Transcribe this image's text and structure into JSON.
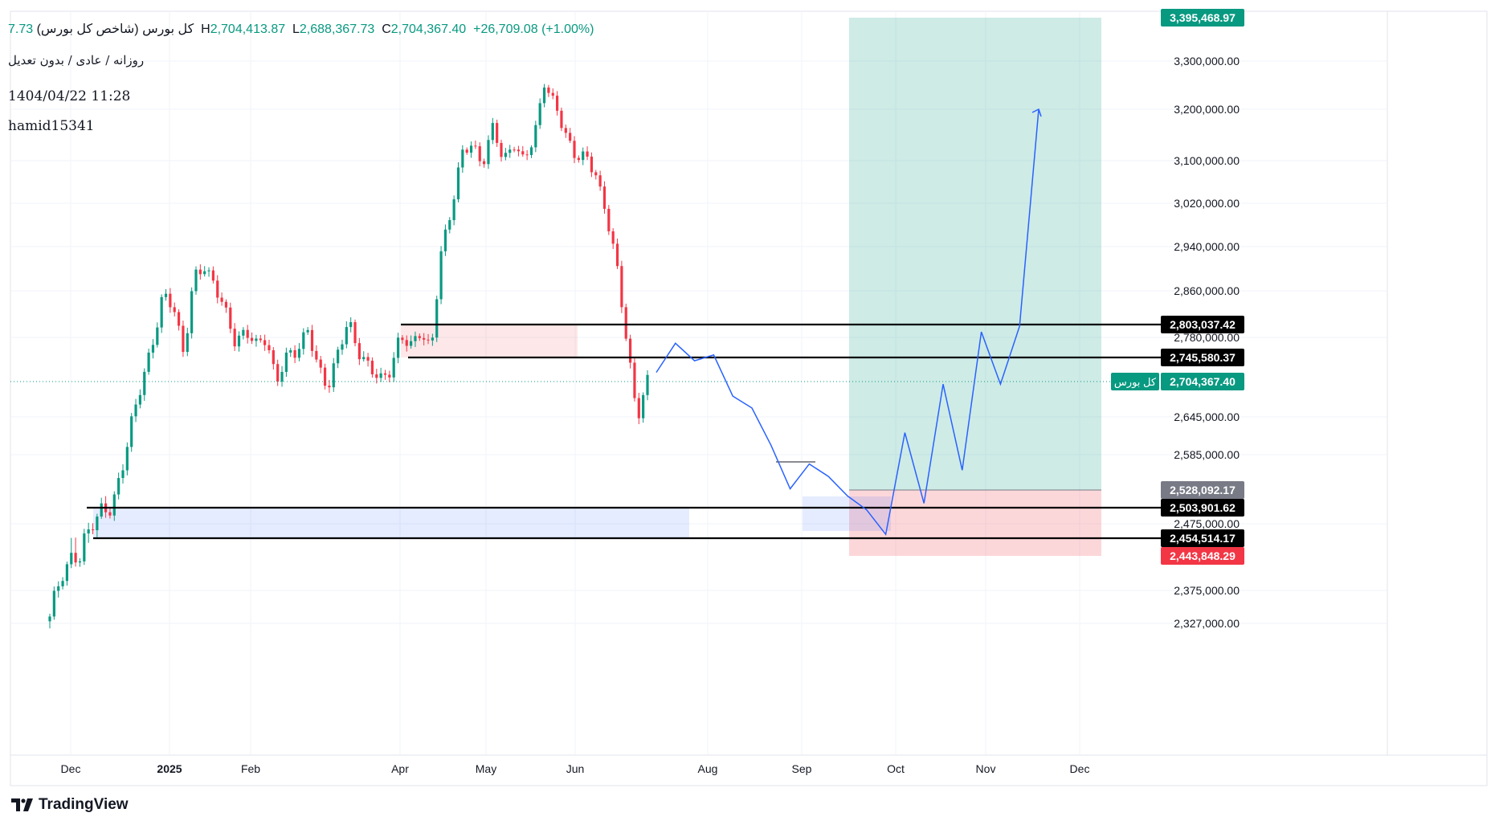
{
  "header": {
    "title": "کل بورس (شاخص کل بورس)",
    "ohlc": [
      {
        "key": "",
        "value": "7.73"
      },
      {
        "key": "H",
        "value": "2,704,413.87"
      },
      {
        "key": "L",
        "value": "2,688,367.73"
      },
      {
        "key": "C",
        "value": "2,704,367.40"
      },
      {
        "key": "",
        "value": "+26,709.08 (+1.00%)"
      }
    ],
    "subtitle": "روزانه / عادی / بدون تعدیل",
    "timestamp": "1404/04/22 11:28",
    "user": "hamid15341"
  },
  "branding": {
    "logo_text": "TradingView"
  },
  "colors": {
    "up": "#089981",
    "down": "#f23645",
    "projection": "#2962ff",
    "target_zone": "#089981",
    "stop_zone": "#f23645",
    "demand_zone": "#2962ff",
    "supply_zone": "#f23645",
    "last_price": "#089981"
  },
  "chart_data": {
    "type": "candlestick",
    "symbol_label": "کل بورس",
    "y_axis_ticks": [
      "3,300,000.00",
      "3,200,000.00",
      "3,100,000.00",
      "3,020,000.00",
      "2,940,000.00",
      "2,860,000.00",
      "2,780,000.00",
      "2,645,000.00",
      "2,585,000.00",
      "2,475,000.00",
      "2,375,000.00",
      "2,327,000.00"
    ],
    "x_axis_ticks": [
      {
        "label": "Dec",
        "bold": false
      },
      {
        "label": "2025",
        "bold": true
      },
      {
        "label": "Feb",
        "bold": false
      },
      {
        "label": "Apr",
        "bold": false
      },
      {
        "label": "May",
        "bold": false
      },
      {
        "label": "Jun",
        "bold": false
      },
      {
        "label": "Aug",
        "bold": false
      },
      {
        "label": "Sep",
        "bold": false
      },
      {
        "label": "Oct",
        "bold": false
      },
      {
        "label": "Nov",
        "bold": false
      },
      {
        "label": "Dec",
        "bold": false
      }
    ],
    "price_tags": [
      {
        "value": "3,395,468.97",
        "kind": "target"
      },
      {
        "value": "2,803,037.42",
        "kind": "level"
      },
      {
        "value": "2,745,580.37",
        "kind": "level"
      },
      {
        "value": "2,704,367.40",
        "kind": "last"
      },
      {
        "value": "2,528,092.17",
        "kind": "entry"
      },
      {
        "value": "2,503,901.62",
        "kind": "level"
      },
      {
        "value": "2,454,514.17",
        "kind": "level"
      },
      {
        "value": "2,443,848.29",
        "kind": "stop"
      }
    ],
    "horizontal_levels": [
      2803037.42,
      2745580.37,
      2503901.62,
      2454514.17
    ],
    "position": {
      "entry": 2528092.17,
      "target": 3395468.97,
      "stop": 2443848.29
    },
    "last_price": 2704367.4,
    "candle_path": [
      2330000,
      2400000,
      2440000,
      2430000,
      2480000,
      2500000,
      2490000,
      2570000,
      2640000,
      2700000,
      2780000,
      2850000,
      2830000,
      2760000,
      2880000,
      2900000,
      2880000,
      2820000,
      2770000,
      2800000,
      2760000,
      2780000,
      2710000,
      2740000,
      2760000,
      2800000,
      2720000,
      2700000,
      2760000,
      2800000,
      2760000,
      2730000,
      2700000,
      2730000,
      2780000,
      2760000,
      2800000,
      2750000,
      2930000,
      3020000,
      3110000,
      3130000,
      3100000,
      3160000,
      3100000,
      3140000,
      3090000,
      3150000,
      3260000,
      3200000,
      3160000,
      3110000,
      3100000,
      3080000,
      3000000,
      2900000,
      2780000,
      2640000,
      2700000
    ],
    "projection_path": [
      2720000,
      2770000,
      2740000,
      2750000,
      2680000,
      2660000,
      2600000,
      2530000,
      2570000,
      2550000,
      2520000,
      2500000,
      2460000,
      2620000,
      2510000,
      2700000,
      2560000,
      2790000,
      2700000,
      2800000,
      3200000
    ]
  }
}
